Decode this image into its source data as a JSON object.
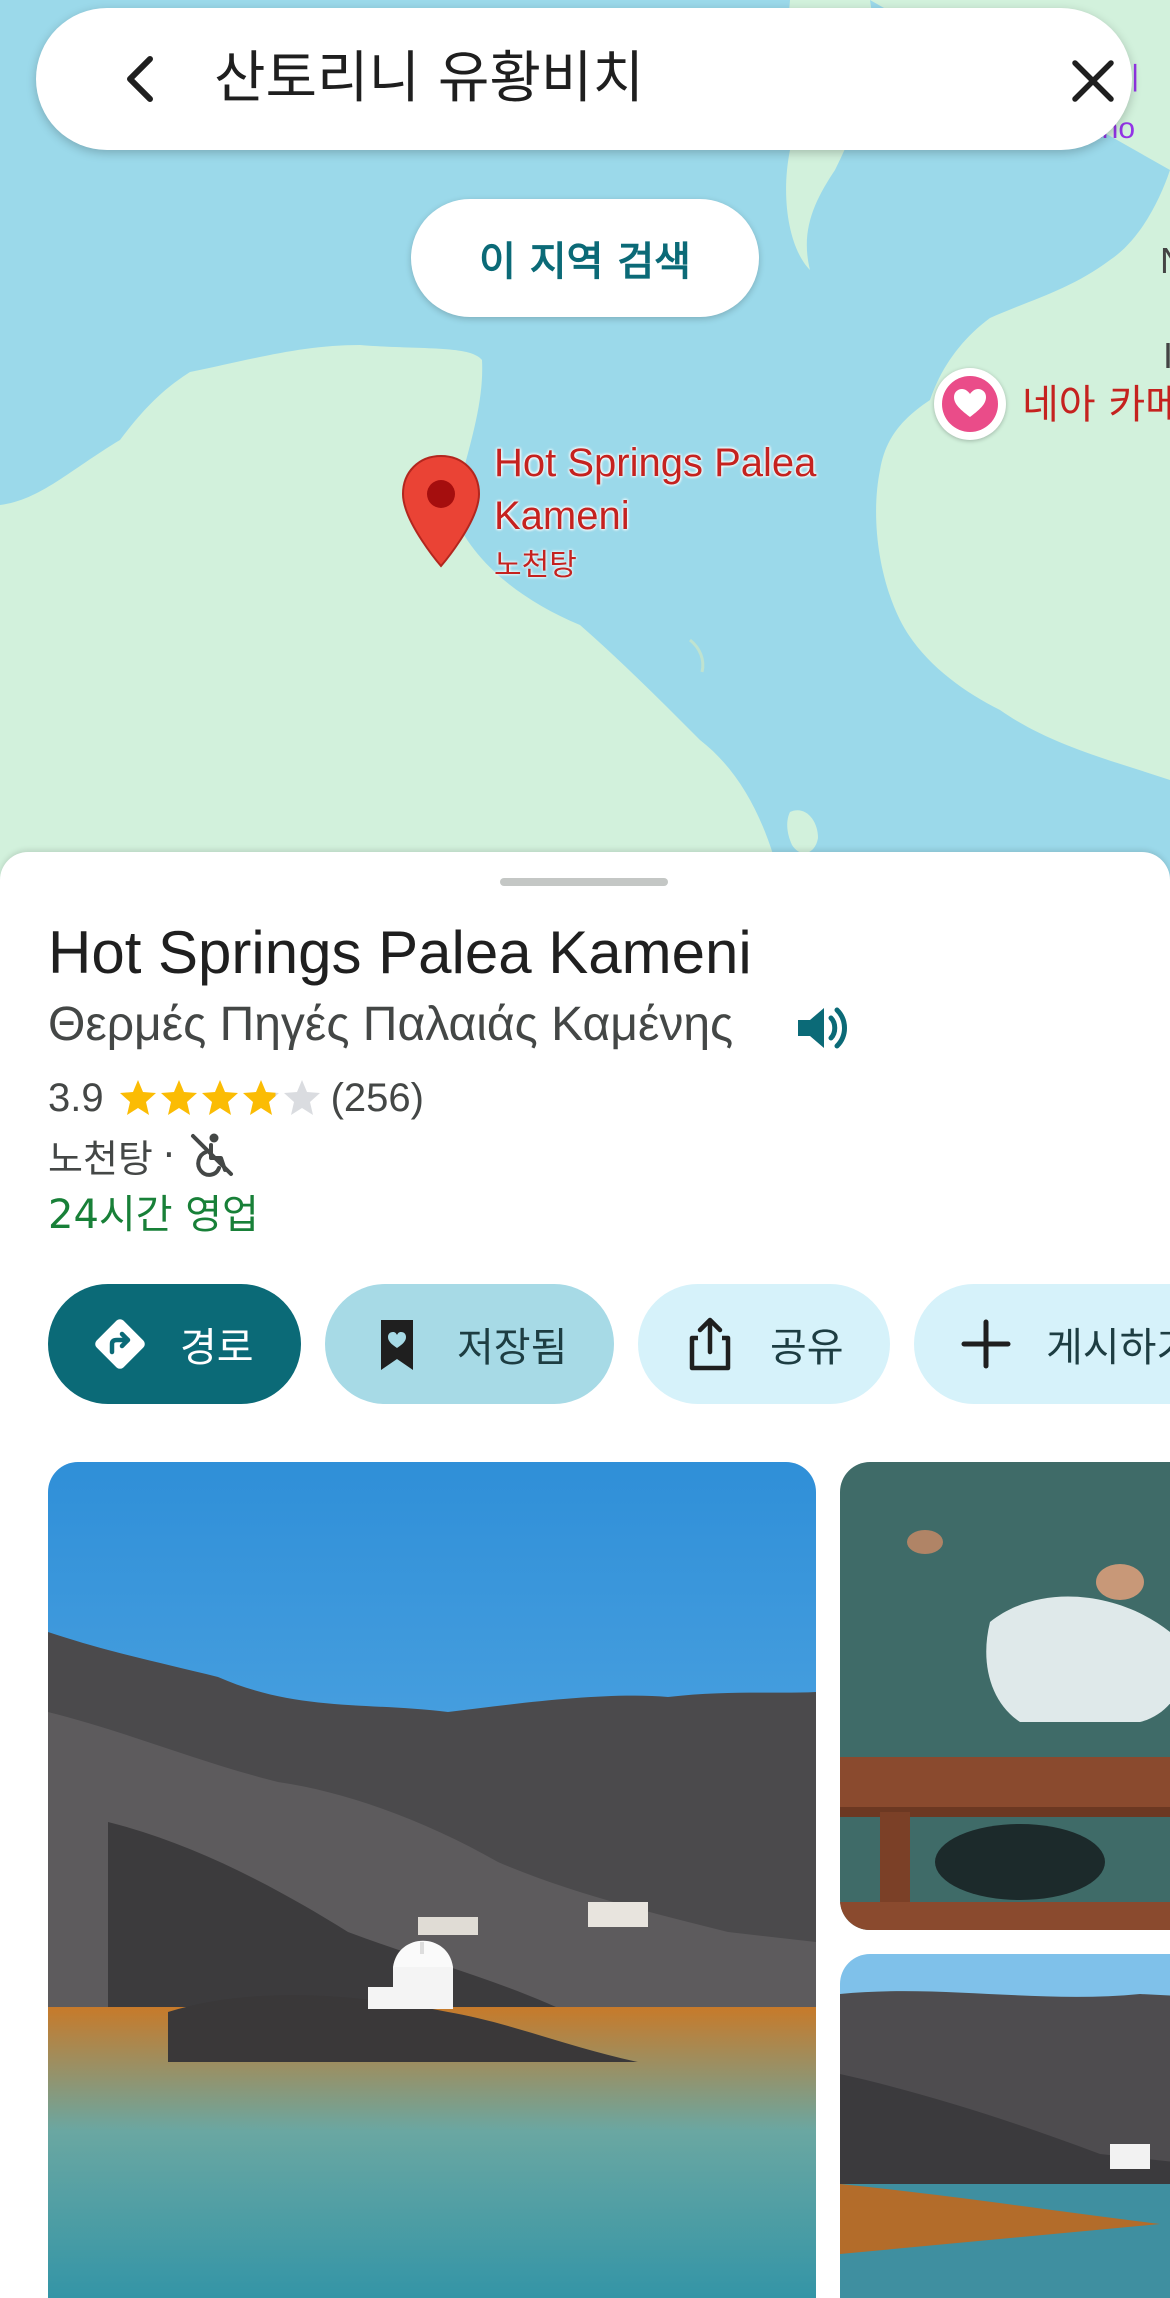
{
  "search": {
    "query": "산토리니 유황비치",
    "back_icon": "arrow-back-icon",
    "close_icon": "close-icon"
  },
  "map": {
    "area_search_label": "이 지역 검색",
    "corner_labels": [
      "트리",
      "ano"
    ],
    "edge_letters": [
      "N",
      "I"
    ],
    "favorite_place_label": "네아 카메",
    "selected_place_label": "Hot Springs Palea Kameni",
    "selected_place_category": "노천탕",
    "colors": {
      "water": "#9bd9ea",
      "land": "#d2f1dc",
      "pin": "#ea4335",
      "favorite": "#ea4c89"
    }
  },
  "place": {
    "name": "Hot Springs Palea Kameni",
    "local_name": "Θερμές Πηγές Παλαιάς Καμένης",
    "rating": "3.9",
    "rating_value": 3.9,
    "review_count": "(256)",
    "category": "노천탕",
    "separator": "·",
    "accessibility_icon": "not-wheelchair-accessible-icon",
    "hours": "24시간 영업"
  },
  "actions": {
    "directions": "경로",
    "saved": "저장됨",
    "share": "공유",
    "post": "게시하기"
  },
  "photos": {
    "count_visible": 3
  }
}
